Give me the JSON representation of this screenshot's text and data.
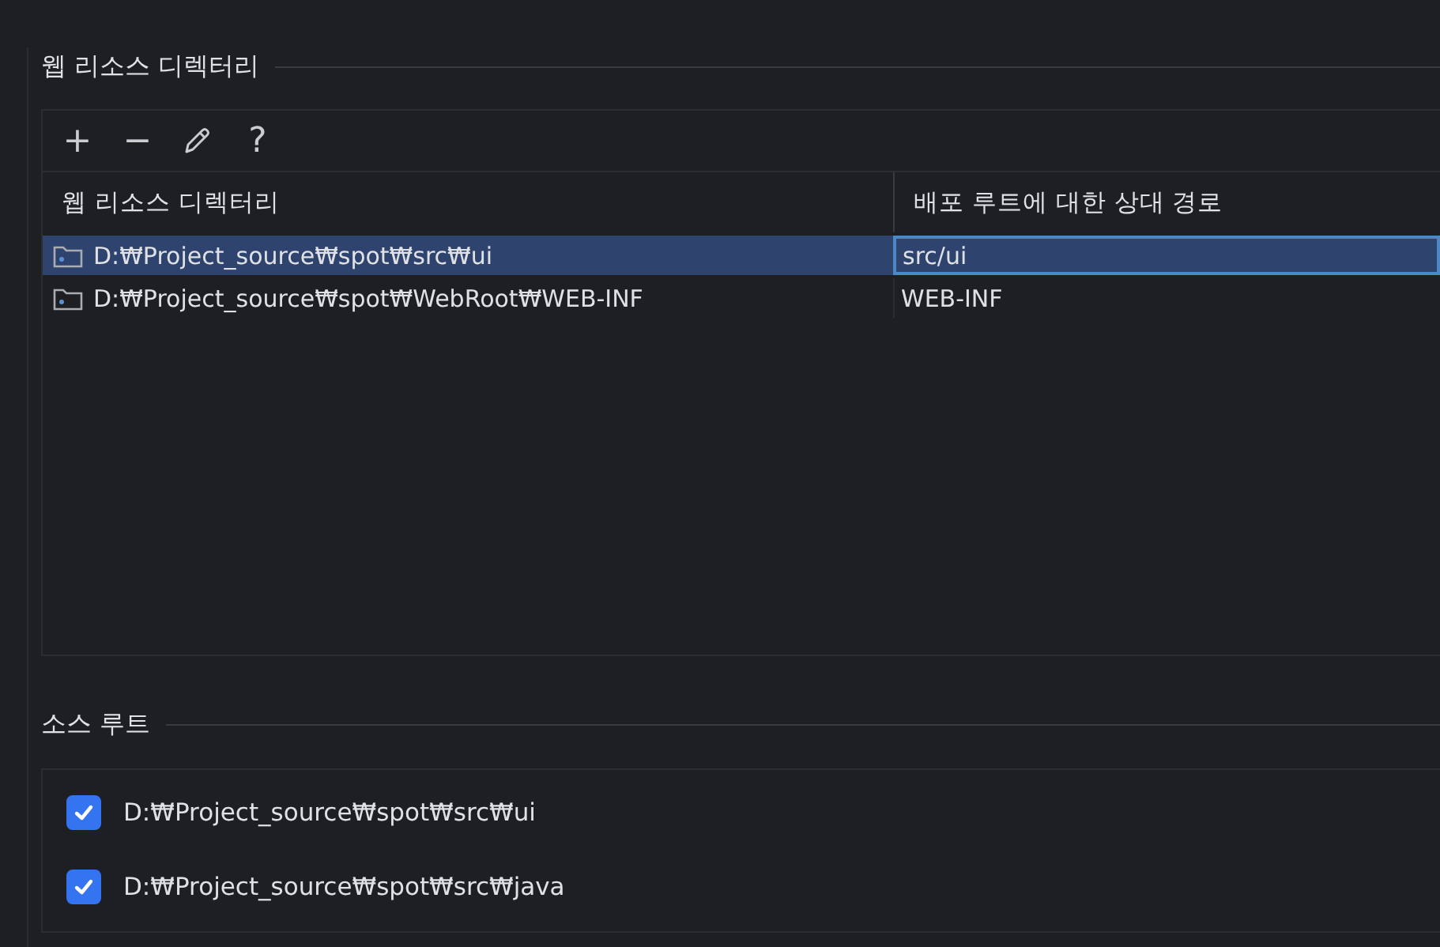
{
  "web_resources": {
    "title": "웹 리소스 디렉터리",
    "toolbar": [
      "+",
      "−",
      "?"
    ],
    "table": {
      "columns": [
        "웹 리소스 디렉터리",
        "배포 루트에 대한 상대 경로"
      ],
      "rows": [
        {
          "directory": "D:₩Project_source₩spot₩src₩ui",
          "relative_path": "src/ui",
          "selected": true
        },
        {
          "directory": "D:₩Project_source₩spot₩WebRoot₩WEB-INF",
          "relative_path": "WEB-INF",
          "selected": false
        }
      ]
    }
  },
  "source_roots": {
    "title": "소스 루트",
    "items": [
      {
        "label": "D:₩Project_source₩spot₩src₩ui",
        "checked": true
      },
      {
        "label": "D:₩Project_source₩spot₩src₩java",
        "checked": true
      }
    ]
  }
}
